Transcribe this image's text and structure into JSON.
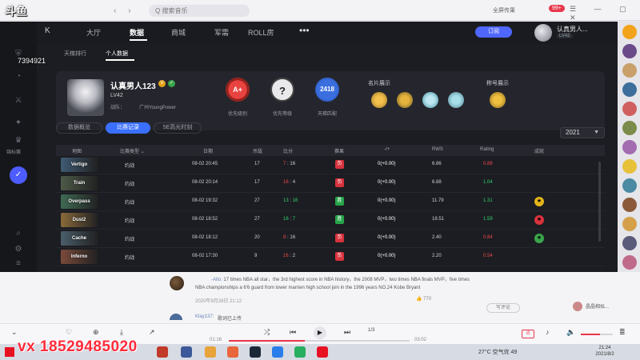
{
  "overlay": {
    "logo": "斗鱼",
    "room_number": "7394921",
    "watermark": "vx 18529485020"
  },
  "browser": {
    "url_placeholder": "Q 搜索音乐",
    "top_right": "全屏传果",
    "badge": "99+"
  },
  "app": {
    "topnav": {
      "back": "K",
      "items": [
        "大厅",
        "数据",
        "商城",
        "军需",
        "ROLL房"
      ],
      "active_index": 1,
      "more": "•••",
      "subscribe": "订阅"
    },
    "user": {
      "name": "认真男人...",
      "level": "LV42"
    },
    "sidebar": {
      "label": "锦标赛"
    },
    "subtabs": [
      "天梯排行",
      "个人数据"
    ],
    "profile": {
      "name": "认真男人123",
      "level": "LV42",
      "club_label": "战队：",
      "club_name": "广州YoungPower",
      "medals": [
        {
          "value": "A+",
          "label": "优先级别"
        },
        {
          "value": "?",
          "label": "优先等级"
        },
        {
          "value": "2418",
          "label": "天梯匹配"
        }
      ],
      "card_section": "名片展示",
      "title_section": "称号展示"
    },
    "pills": [
      "数据概览",
      "比赛记录",
      "5E高光时刻"
    ],
    "year": "2021",
    "table": {
      "headers": [
        "地图",
        "比赛类型 ⌄",
        "日期",
        "杀敌",
        "比分",
        "赛果",
        "-/+",
        "RWS",
        "Rating",
        "成就"
      ],
      "rows": [
        {
          "map": "Vertigo",
          "type": "约战",
          "date": "08-02 20:45",
          "kills": "17",
          "score_a": "7",
          "score_b": "16",
          "result": "负",
          "result_type": "loss",
          "delta": "0(+0.00)",
          "rws": "6.86",
          "rating": "0.88",
          "rating_color": "red",
          "achievement": ""
        },
        {
          "map": "Train",
          "type": "约战",
          "date": "08-02 20:14",
          "kills": "17",
          "score_a": "16",
          "score_b": "4",
          "result": "负",
          "result_type": "loss",
          "delta": "0(+0.00)",
          "rws": "6.88",
          "rating": "1.04",
          "rating_color": "green",
          "achievement": ""
        },
        {
          "map": "Overpass",
          "type": "约战",
          "date": "08-02 19:32",
          "kills": "27",
          "score_a": "13",
          "score_b": "16",
          "result": "胜",
          "result_type": "win",
          "delta": "0(+0.00)",
          "rws": "11.79",
          "rating": "1.31",
          "rating_color": "green",
          "achievement": "yellow"
        },
        {
          "map": "Dust2",
          "type": "约战",
          "date": "08-02 18:52",
          "kills": "27",
          "score_a": "16",
          "score_b": "7",
          "result": "胜",
          "result_type": "win",
          "delta": "0(+0.00)",
          "rws": "18.51",
          "rating": "1.59",
          "rating_color": "green",
          "achievement": "red"
        },
        {
          "map": "Cache",
          "type": "约战",
          "date": "08-02 18:12",
          "kills": "20",
          "score_a": "8",
          "score_b": "16",
          "result": "负",
          "result_type": "loss",
          "delta": "0(+0.00)",
          "rws": "2.40",
          "rating": "0.84",
          "rating_color": "red",
          "achievement": "green"
        },
        {
          "map": "Inferno",
          "type": "约战",
          "date": "08-02 17:30",
          "kills": "9",
          "score_a": "16",
          "score_b": "2",
          "result": "负",
          "result_type": "loss",
          "delta": "0(+0.00)",
          "rws": "2.20",
          "rating": "0.54",
          "rating_color": "red",
          "achievement": ""
        }
      ]
    }
  },
  "comments": {
    "user": "-Allo:",
    "text": "17 times NBA all star，the 3rd highest score in NBA history，the 2008 MVP，two times NBA finals MVP，five times NBA championships a 6'6 guard from lower marrien high school join in the 1996 years NO.24 Kobe Bryant",
    "time": "2020年8月28日 21:12",
    "likes": "770",
    "reply_btn": "写评论",
    "user2": "Klay137:",
    "user2_text": "歌词已上传",
    "side_user": "晶晶相似..."
  },
  "player": {
    "time_current": "01:16",
    "time_total": "03:02",
    "progress": 0.42,
    "volume": 0.6,
    "lyric": "词",
    "track_index": "1/3"
  },
  "taskbar": {
    "weather": "27°C  空气优 49",
    "time": "21:24",
    "date": "2021/8/2"
  }
}
